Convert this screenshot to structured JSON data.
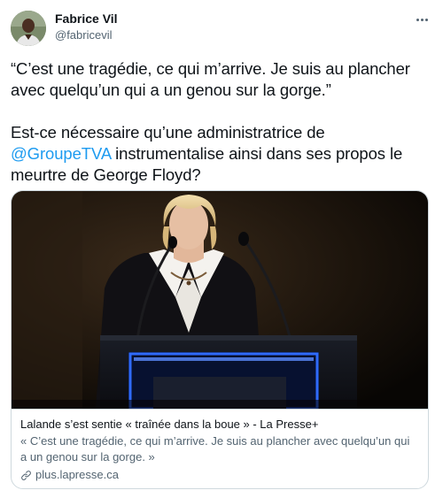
{
  "author": {
    "display_name": "Fabrice Vil",
    "handle": "@fabricevil",
    "avatar_icon": "profile-photo"
  },
  "more_icon": "more-horizontal-icon",
  "tweet": {
    "quote": "“C’est une tragédie, ce qui m’arrive. Je suis au plancher avec quelqu’un qui a un genou sur la gorge.”",
    "line2_prefix": "Est-ce nécessaire qu’une administratrice de",
    "mention": "@GroupeTVA",
    "line2_suffix": " instrumentalise ainsi dans ses propos le meurtre de George Floyd?"
  },
  "card": {
    "title": "Lalande s’est sentie « traînée dans la boue » - La Presse+",
    "description": "« C’est une tragédie, ce qui m’arrive. Je suis au plancher avec quelqu’un qui a un genou sur la gorge. »",
    "domain": "plus.lapresse.ca",
    "domain_icon": "link-icon"
  },
  "colors": {
    "accent": "#1d9bf0",
    "text": "#0f1419",
    "secondary": "#536471",
    "border": "#cfd9de",
    "podium_glow": "#2f6bff"
  }
}
